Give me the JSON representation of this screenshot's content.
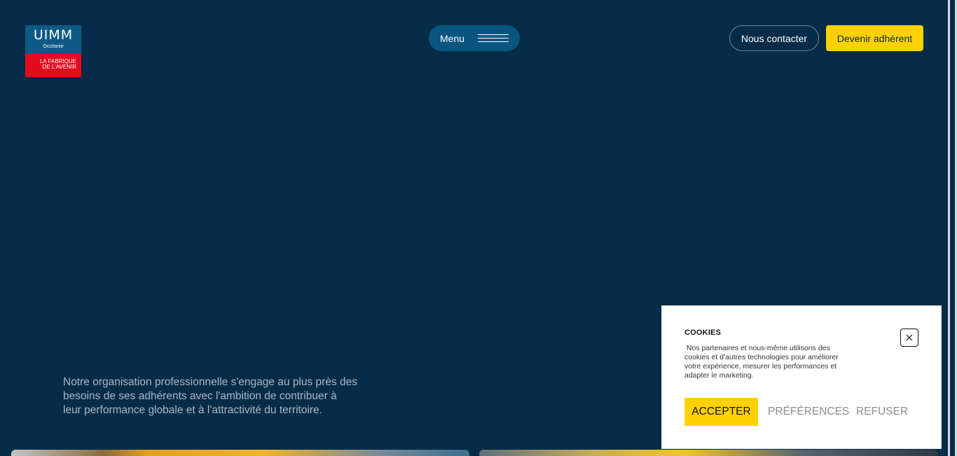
{
  "logo": {
    "title": "UIMM",
    "region": "Occitanie",
    "tagline_line1": "LA FABRIQUE",
    "tagline_line2": "DE L'AVENIR"
  },
  "header": {
    "menu_label": "Menu",
    "contact_label": "Nous contacter",
    "join_label": "Devenir adhérent"
  },
  "hero": {
    "intro": "Notre organisation professionnelle s'engage au plus près des besoins de ses adhérents avec l'ambition de contribuer à leur performance globale et à l'attractivité du territoire."
  },
  "cookie_banner": {
    "title": "COOKIES",
    "text": " Nos partenaires et nous-même utilisons des cookies et d'autres technologies pour améliorer votre expérience, mesurer les performances et adapter le marketing.",
    "accept_label": "ACCEPTER",
    "preferences_label": "PRÉFÉRENCES",
    "refuse_label": "REFUSER"
  },
  "colors": {
    "background": "#072c47",
    "menu_pill": "#085580",
    "accent_yellow": "#ffd100",
    "logo_blue": "#0d5a84",
    "logo_red": "#e30b1c"
  },
  "icons": {
    "menu": "hamburger-icon",
    "close": "close-icon"
  }
}
